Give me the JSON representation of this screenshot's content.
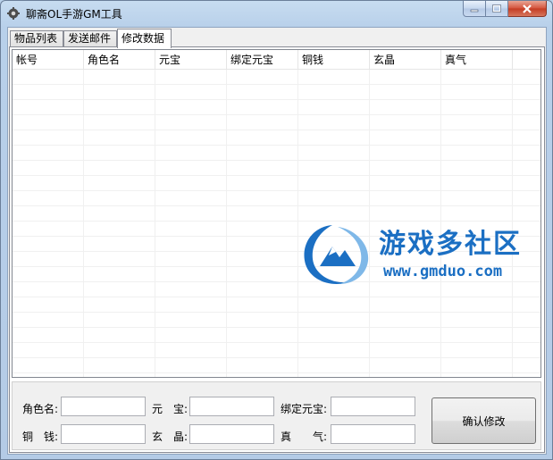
{
  "window": {
    "title": "聊斋OL手游GM工具",
    "controls": {
      "minimize": "─",
      "maximize": "□",
      "close": "✕"
    }
  },
  "tabs": [
    {
      "label": "物品列表",
      "active": false
    },
    {
      "label": "发送邮件",
      "active": false
    },
    {
      "label": "修改数据",
      "active": true
    }
  ],
  "table": {
    "columns": [
      "帐号",
      "角色名",
      "元宝",
      "绑定元宝",
      "铜钱",
      "玄晶",
      "真气"
    ],
    "rows": []
  },
  "watermark": {
    "text": "游戏多社区",
    "url": "www.gmduo.com",
    "color": "#1b6fc3"
  },
  "form": {
    "labels": {
      "role_name": "角色名:",
      "yuanbao": "元　宝:",
      "bound_yuanbao": "绑定元宝:",
      "copper": "铜　钱:",
      "xuanjing": "玄　晶:",
      "zhenqi": "真　　气:"
    },
    "values": {
      "role_name": "",
      "yuanbao": "",
      "bound_yuanbao": "",
      "copper": "",
      "xuanjing": "",
      "zhenqi": ""
    },
    "confirm_button": "确认修改"
  },
  "icons": {
    "app": "gear-icon",
    "minimize": "minimize-icon",
    "maximize": "maximize-icon",
    "close": "close-icon",
    "watermark_logo": "mountain-logo-icon"
  }
}
